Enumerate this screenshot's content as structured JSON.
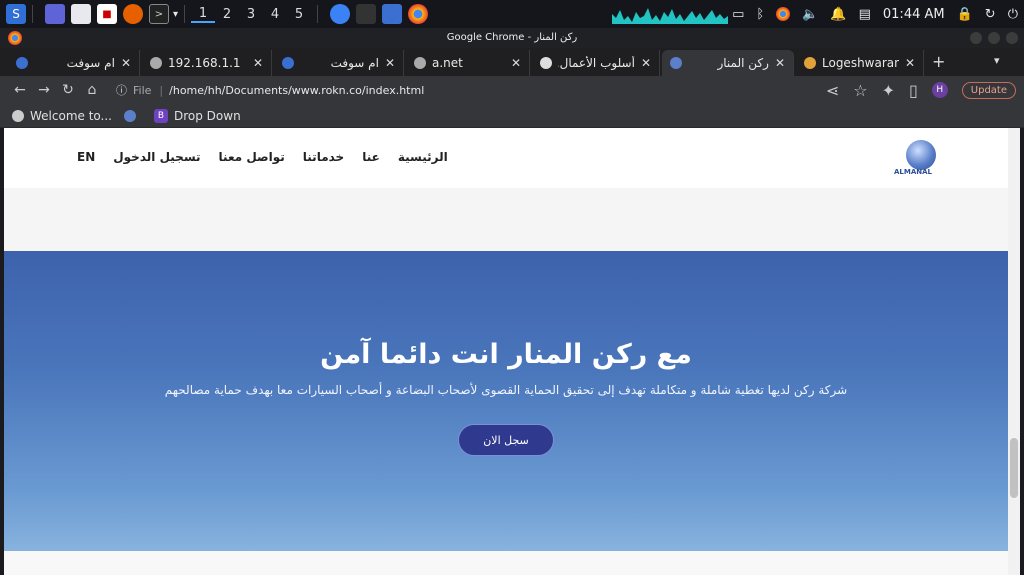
{
  "taskbar": {
    "workspaces": [
      "1",
      "2",
      "3",
      "4",
      "5"
    ],
    "clock": "01:44 AM"
  },
  "window": {
    "title": "Google Chrome - ركن المنار"
  },
  "tabs": [
    {
      "label": "ام سوفت"
    },
    {
      "label": "192.168.1.1"
    },
    {
      "label": "ام سوفت"
    },
    {
      "label": "a.net"
    },
    {
      "label": "أسلوب الأعمال."
    },
    {
      "label": "ركن المنار"
    },
    {
      "label": "Logeshwaran.o"
    }
  ],
  "toolbar": {
    "file_label": "File",
    "url": "/home/hh/Documents/www.rokn.co/index.html",
    "profile_initial": "H",
    "update_label": "Update"
  },
  "bookmarks": [
    {
      "label": "Welcome to..."
    },
    {
      "label": "Drop Down",
      "badge": "B"
    }
  ],
  "site": {
    "nav": {
      "items": [
        "EN",
        "تسجيل الدخول",
        "تواصل معنا",
        "خدماتنا",
        "عنا",
        "الرئيسية"
      ]
    },
    "logo_text": "ALMANAL",
    "hero": {
      "title": "مع ركن المنار انت دائما آمن",
      "subtitle": "شركة ركن لديها تغطية شاملة و متكاملة تهدف إلى تحقيق الحماية القصوى لأصحاب البضاعة و أصحاب السيارات معا بهدف حماية مصالحهم",
      "cta": "سجل الان"
    }
  },
  "colors": {
    "hero_top": "#3d62ad",
    "hero_bottom": "#88b2de",
    "cta_bg": "#2f3a8f"
  }
}
